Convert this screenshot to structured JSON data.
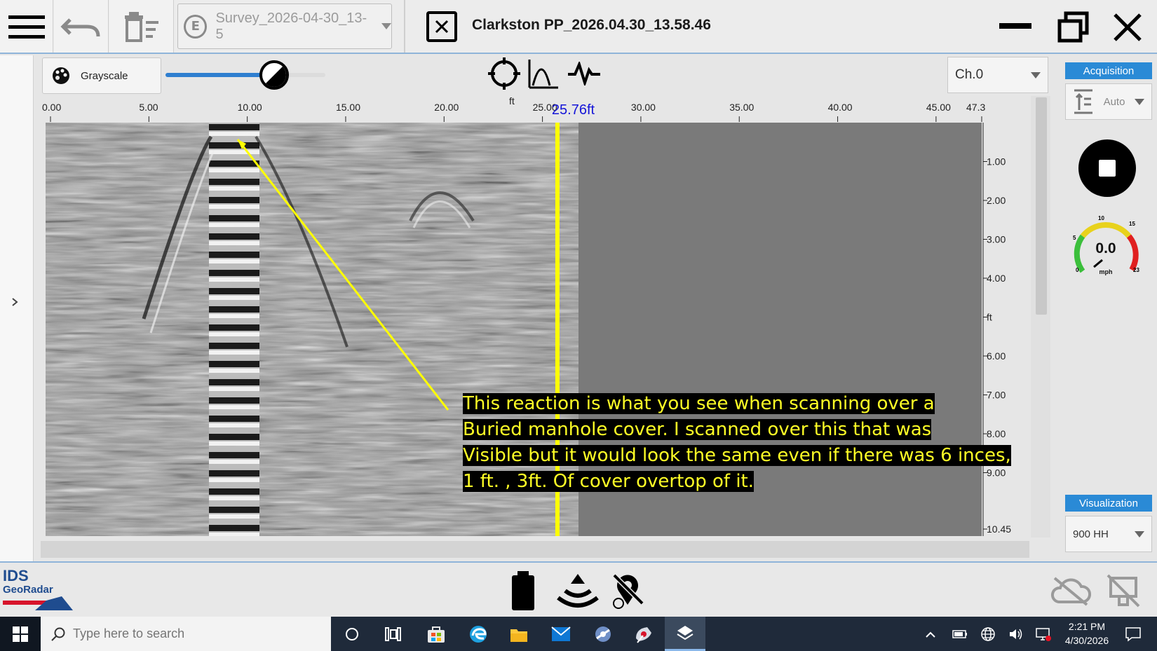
{
  "window": {
    "title": "Clarkston PP_2026.04.30_13.58.46",
    "survey_select": "Survey_2026-04-30_13-5",
    "survey_badge": "E"
  },
  "toolbar": {
    "palette_label": "Grayscale",
    "contrast_level": 0.68,
    "channel": "Ch.0"
  },
  "scan": {
    "x_unit": "ft",
    "x_ticks": [
      "0.00",
      "5.00",
      "10.00",
      "15.00",
      "20.00",
      "25.00",
      "30.00",
      "35.00",
      "40.00",
      "45.00",
      "47.32"
    ],
    "cursor_readout": "25.76ft",
    "depth_unit": "ft",
    "depth_ticks": [
      "1.00",
      "2.00",
      "3.00",
      "4.00",
      "6.00",
      "7.00",
      "8.00",
      "9.00",
      "10.45"
    ],
    "cursor_color": "#ffff00"
  },
  "annotation": {
    "lines": [
      "This reaction is what you see when scanning over a",
      "Buried manhole cover. I scanned over this that was",
      "Visible but it would look the same even if there was 6 inces,",
      "1 ft. , 3ft. Of cover overtop of it."
    ],
    "text_color": "#ffff26"
  },
  "right_panel": {
    "acquisition_label": "Acquisition",
    "gain_mode": "Auto",
    "speed_value": "0.0",
    "speed_unit": "mph",
    "gauge_ticks": [
      "0",
      "5",
      "10",
      "15",
      "23"
    ],
    "visualization_label": "Visualization",
    "antenna": "900 HH"
  },
  "brand": {
    "line1": "IDS",
    "line2": "GeoRadar"
  },
  "taskbar": {
    "search_placeholder": "Type here to search",
    "time": "2:21 PM",
    "date": "4/30/2026"
  },
  "colors": {
    "accent": "#2a8ad6",
    "brand_red": "#d7142b",
    "brand_blue": "#1f4c8f"
  }
}
